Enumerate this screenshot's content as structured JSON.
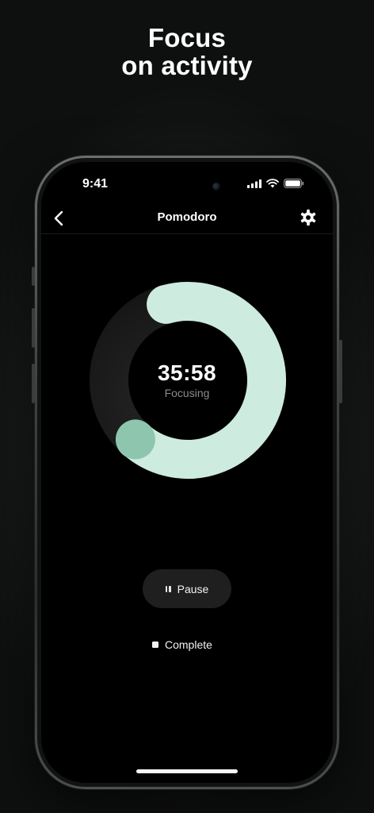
{
  "headline": {
    "line1": "Focus",
    "line2": "on activity"
  },
  "status_bar": {
    "time": "9:41"
  },
  "nav": {
    "title": "Pomodoro"
  },
  "timer": {
    "time": "35:58",
    "state": "Focusing",
    "progress": 0.66,
    "track_color": "#1b1c1b",
    "progress_color": "#cdebdf",
    "knob_color": "#8ec5ae"
  },
  "controls": {
    "pause_label": "Pause",
    "complete_label": "Complete"
  },
  "icons": {
    "back": "chevron-left-icon",
    "settings": "gear-icon",
    "pause": "pause-icon",
    "stop": "stop-icon"
  }
}
